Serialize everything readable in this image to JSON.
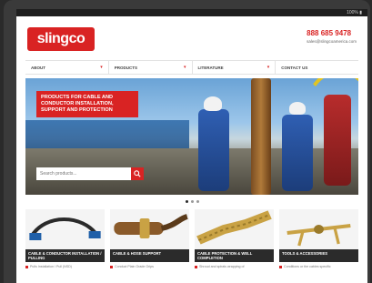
{
  "statusbar": {
    "text": "100% ▮"
  },
  "header": {
    "logo_text": "slingco",
    "phone": "888 685 9478",
    "email": "sales@slingcoamerica.com"
  },
  "nav": {
    "items": [
      {
        "label": "ABOUT",
        "chevron": "▾"
      },
      {
        "label": "PRODUCTS",
        "chevron": "▾"
      },
      {
        "label": "LITERATURE",
        "chevron": "▾"
      },
      {
        "label": "CONTACT US",
        "chevron": ""
      }
    ]
  },
  "hero": {
    "banner_text": "PRODUCTS FOR CABLE AND CONDUCTOR INSTALLATION, SUPPORT AND PROTECTION",
    "search_placeholder": "Search products..."
  },
  "carousel": {
    "slides": 3,
    "active_index": 0
  },
  "tiles": [
    {
      "caption": "CABLE & CONDUCTOR INSTALLATION / PULLING",
      "desc": "Pulls Installation / Pull (NSD)"
    },
    {
      "caption": "CABLE & HOSE SUPPORT",
      "desc": "Conduct Plain Grade Grips"
    },
    {
      "caption": "CABLE PROTECTION & WELL COMPLETION",
      "desc": "Shroud and spirals wrapping of"
    },
    {
      "caption": "TOOLS & ACCESSORIES",
      "desc": "Conditions or the cables specific"
    }
  ],
  "colors": {
    "brand_red": "#d92323",
    "dark": "#2b2b2b"
  }
}
